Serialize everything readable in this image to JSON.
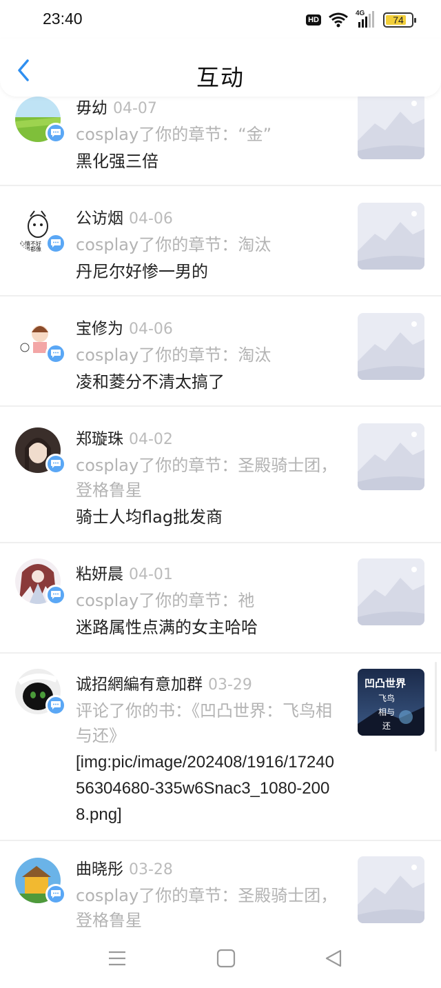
{
  "status_bar": {
    "time": "23:40",
    "hd_label": "HD",
    "network_label": "4G",
    "battery_level": "74",
    "icons": [
      "hd-icon",
      "wifi-icon",
      "cellular-signal-icon",
      "battery-icon"
    ]
  },
  "header": {
    "title": "互动",
    "back_icon": "chevron-left-icon",
    "accent_color": "#2f8ff0"
  },
  "items": [
    {
      "name": "毋幼",
      "date": "04-07",
      "action": "cosplay了你的章节：“金”",
      "comment": "黑化强三倍"
    },
    {
      "name": "公访烟",
      "date": "04-06",
      "action": "cosplay了你的章节：淘汰",
      "comment": "丹尼尔好惨一男的"
    },
    {
      "name": "宝修为",
      "date": "04-06",
      "action": "cosplay了你的章节：淘汰",
      "comment": "凌和菱分不清太搞了"
    },
    {
      "name": "郑璇珠",
      "date": "04-02",
      "action": "cosplay了你的章节：圣殿骑士团，登格鲁星",
      "comment": "骑士人均flag批发商"
    },
    {
      "name": "粘妍晨",
      "date": "04-01",
      "action": "cosplay了你的章节：祂",
      "comment": "迷路属性点满的女主哈哈"
    },
    {
      "name": "诚招網編有意加群",
      "date": "03-29",
      "action": "评论了你的书：《凹凸世界：飞鸟相与还》",
      "comment": "[img:pic/image/202408/1916/1724056304680-335w6Snac3_1080-2008.png]",
      "thumb_title": "凹凸世界",
      "thumb_sub1": "飞鸟",
      "thumb_sub2": "相与",
      "thumb_sub3": "还"
    },
    {
      "name": "曲晓彤",
      "date": "03-28",
      "action": "cosplay了你的章节：圣殿骑士团，登格鲁星",
      "comment": ""
    }
  ],
  "nav_bar": {
    "icons": [
      "menu-icon",
      "home-square-icon",
      "back-triangle-icon"
    ]
  }
}
